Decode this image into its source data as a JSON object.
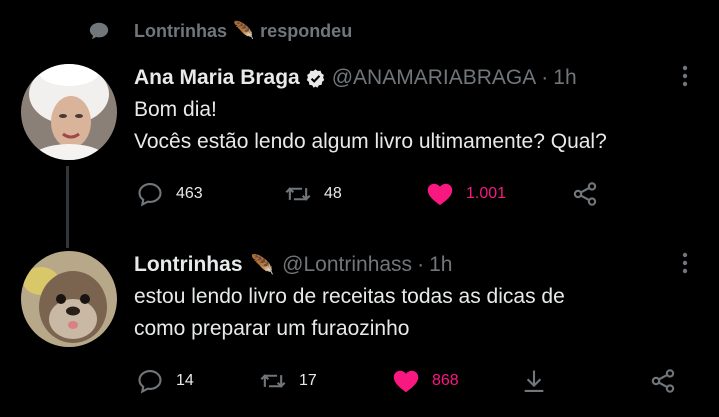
{
  "context": {
    "user": "Lontrinhas",
    "emoji": "🪶",
    "verb": "respondeu"
  },
  "tweets": [
    {
      "name": "Ana Maria Braga",
      "verified": true,
      "handle": "@ANAMARIABRAGA",
      "separator": "·",
      "time": "1h",
      "lines": [
        "Bom dia!",
        "Vocês estão lendo algum livro ultimamente? Qual?"
      ],
      "replies": "463",
      "retweets": "48",
      "likes": "1.001"
    },
    {
      "name": "Lontrinhas",
      "emoji": "🪶",
      "handle": "@Lontrinhass",
      "separator": "·",
      "time": "1h",
      "lines": [
        "estou lendo livro de receitas todas as dicas de",
        "como preparar um furaozinho"
      ],
      "replies": "14",
      "retweets": "17",
      "likes": "868"
    }
  ],
  "colors": {
    "background": "#000000",
    "text": "#e7e9ea",
    "muted": "#71767b",
    "like": "#f91880",
    "verified_badge": "#e7e9ea"
  }
}
